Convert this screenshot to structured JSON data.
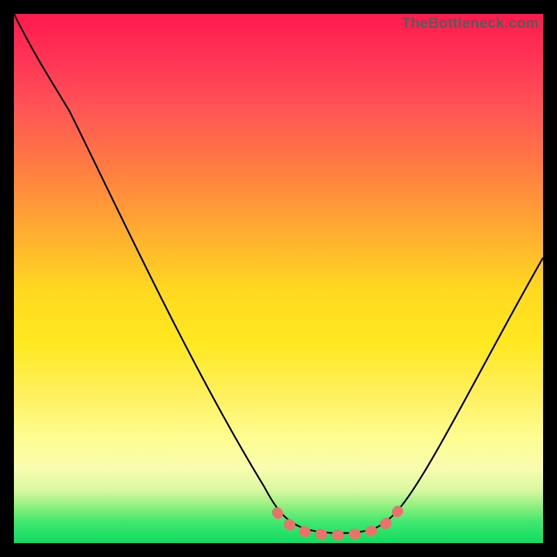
{
  "watermark": "TheBottleneck.com",
  "chart_data": {
    "type": "line",
    "title": "",
    "xlabel": "",
    "ylabel": "",
    "xlim": [
      0,
      100
    ],
    "ylim": [
      0,
      100
    ],
    "grid": false,
    "series": [
      {
        "name": "bottleneck-curve",
        "color": "#000000",
        "points": [
          {
            "x": 0,
            "y": 100
          },
          {
            "x": 5,
            "y": 94
          },
          {
            "x": 10,
            "y": 86
          },
          {
            "x": 18,
            "y": 70
          },
          {
            "x": 26,
            "y": 54
          },
          {
            "x": 34,
            "y": 38
          },
          {
            "x": 42,
            "y": 22
          },
          {
            "x": 48,
            "y": 10
          },
          {
            "x": 52,
            "y": 5
          },
          {
            "x": 56,
            "y": 3
          },
          {
            "x": 60,
            "y": 3
          },
          {
            "x": 64,
            "y": 3
          },
          {
            "x": 68,
            "y": 4
          },
          {
            "x": 72,
            "y": 7
          },
          {
            "x": 78,
            "y": 16
          },
          {
            "x": 84,
            "y": 28
          },
          {
            "x": 90,
            "y": 42
          },
          {
            "x": 96,
            "y": 57
          },
          {
            "x": 100,
            "y": 66
          }
        ]
      },
      {
        "name": "highlight-zone",
        "color": "#e8736b",
        "x_range": [
          50,
          70
        ],
        "note": "dotted wide stroke along curve bottom (optimal region)"
      }
    ],
    "annotations": []
  },
  "colors": {
    "frame": "#000000",
    "curve": "#000000",
    "highlight": "#e8736b",
    "gradient_top": "#ff1a4d",
    "gradient_bottom": "#10dc60"
  }
}
